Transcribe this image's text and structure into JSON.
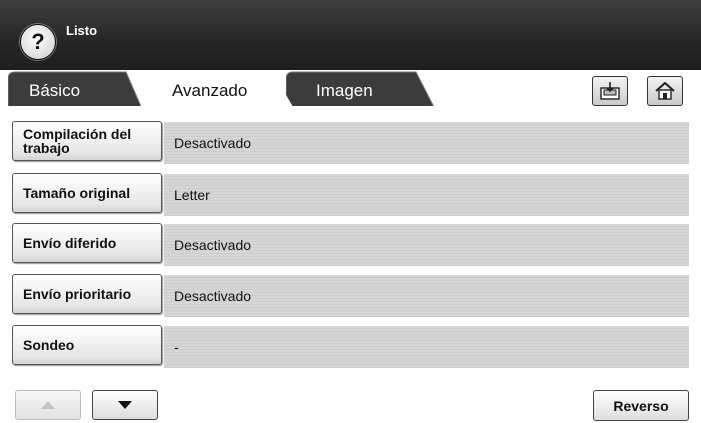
{
  "header": {
    "status": "Listo",
    "help_symbol": "?"
  },
  "tabs": [
    {
      "label": "Básico",
      "active": false
    },
    {
      "label": "Avanzado",
      "active": true
    },
    {
      "label": "Imagen",
      "active": false
    }
  ],
  "toolbar": {
    "icons": [
      "tray-icon",
      "home-icon"
    ]
  },
  "rows": [
    {
      "label": "Compilación del trabajo",
      "value": "Desactivado"
    },
    {
      "label": "Tamaño original",
      "value": "Letter"
    },
    {
      "label": "Envío diferido",
      "value": "Desactivado"
    },
    {
      "label": "Envío prioritario",
      "value": "Desactivado"
    },
    {
      "label": "Sondeo",
      "value": "-"
    }
  ],
  "footer": {
    "reverse_label": "Reverso",
    "up_enabled": false,
    "down_enabled": true
  },
  "colors": {
    "header_bg": "#262626",
    "tab_inactive": "#3a3a3a",
    "tab_active": "#ffffff",
    "value_bg": "#d4d4d4"
  }
}
